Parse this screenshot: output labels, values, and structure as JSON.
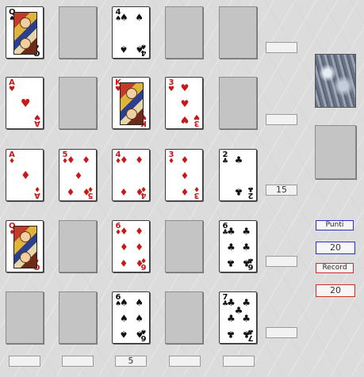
{
  "colors": {
    "background": "#dcdcdc",
    "empty_slot": "#c4c4c4",
    "red_suit": "#c81818",
    "black_suit": "#111111",
    "points_border": "#2b2bd0",
    "record_border": "#d02b2b"
  },
  "grid": [
    [
      {
        "rank": "Q",
        "suit": "♠",
        "color": "black"
      },
      null,
      {
        "rank": "4",
        "suit": "♠",
        "color": "black"
      },
      null,
      null
    ],
    [
      {
        "rank": "A",
        "suit": "♥",
        "color": "red"
      },
      null,
      {
        "rank": "K",
        "suit": "♥",
        "color": "red"
      },
      {
        "rank": "3",
        "suit": "♥",
        "color": "red"
      },
      null
    ],
    [
      {
        "rank": "A",
        "suit": "♦",
        "color": "red"
      },
      {
        "rank": "5",
        "suit": "♦",
        "color": "red"
      },
      {
        "rank": "4",
        "suit": "♦",
        "color": "red"
      },
      {
        "rank": "3",
        "suit": "♦",
        "color": "red"
      },
      {
        "rank": "2",
        "suit": "♣",
        "color": "black"
      }
    ],
    [
      {
        "rank": "Q",
        "suit": "♦",
        "color": "red"
      },
      null,
      {
        "rank": "6",
        "suit": "♦",
        "color": "red"
      },
      null,
      {
        "rank": "6",
        "suit": "♣",
        "color": "black"
      }
    ],
    [
      null,
      null,
      {
        "rank": "6",
        "suit": "♠",
        "color": "black"
      },
      null,
      {
        "rank": "7",
        "suit": "♣",
        "color": "black"
      }
    ]
  ],
  "row_scores": [
    "",
    "",
    "15",
    "",
    ""
  ],
  "col_scores": [
    "",
    "",
    "5",
    "",
    ""
  ],
  "deck": {
    "icon": "card-back-icon"
  },
  "panel": {
    "points_label": "Punti",
    "points_value": "20",
    "record_label": "Record",
    "record_value": "20"
  }
}
